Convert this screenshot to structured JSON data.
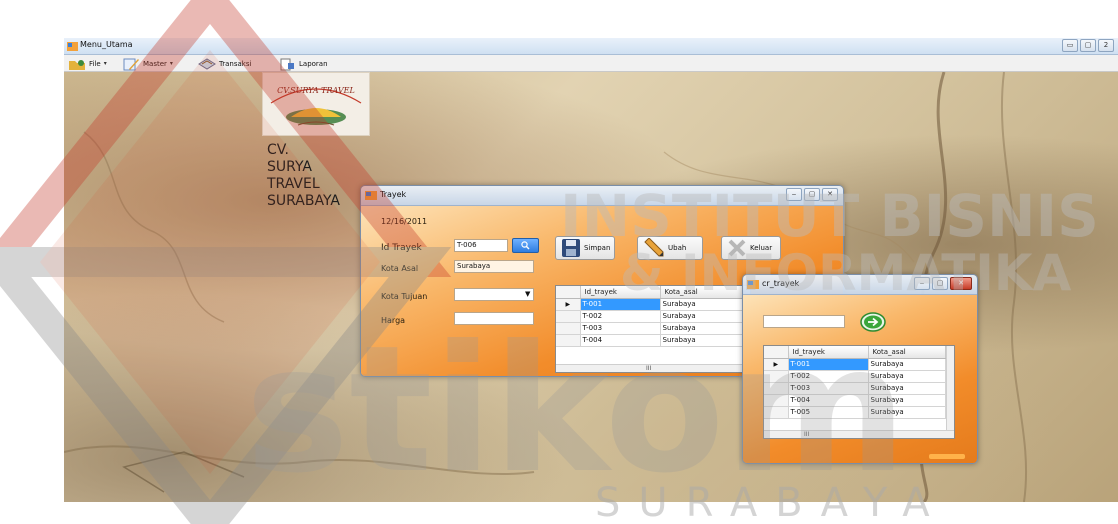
{
  "main_window": {
    "title": "Menu_Utama",
    "caption_buttons": [
      "▭",
      "▢",
      "2"
    ]
  },
  "menu": [
    {
      "label": "File",
      "icon": "folder-icon"
    },
    {
      "label": "Master",
      "icon": "notepad-icon"
    },
    {
      "label": "Transaksi",
      "icon": "book-icon"
    },
    {
      "label": "Laporan",
      "icon": "report-icon"
    }
  ],
  "logo": {
    "image_text": "CV.SURYA TRAVEL",
    "lines": [
      "CV.",
      "SURYA",
      "TRAVEL",
      "SURABAYA"
    ]
  },
  "trayek_dialog": {
    "title": "Trayek",
    "date": "12/16/2011",
    "id_label": "Id Trayek",
    "id_value": "T-006",
    "asal_label": "Kota Asal",
    "asal_value": "Surabaya",
    "tujuan_label": "Kota Tujuan",
    "tujuan_value": "",
    "harga_label": "Harga",
    "harga_value": "",
    "buttons": {
      "simpan": "Simpan",
      "ubah": "Ubah",
      "keluar": "Keluar"
    },
    "grid": {
      "columns": [
        "Id_trayek",
        "Kota_asal"
      ],
      "rows": [
        [
          "T-001",
          "Surabaya"
        ],
        [
          "T-002",
          "Surabaya"
        ],
        [
          "T-003",
          "Surabaya"
        ],
        [
          "T-004",
          "Surabaya"
        ]
      ],
      "scroll_text": "III"
    }
  },
  "cr_trayek_dialog": {
    "title": "cr_trayek",
    "search_value": "",
    "grid": {
      "columns": [
        "Id_trayek",
        "Kota_asal"
      ],
      "rows": [
        [
          "T-001",
          "Surabaya"
        ],
        [
          "T-002",
          "Surabaya"
        ],
        [
          "T-003",
          "Surabaya"
        ],
        [
          "T-004",
          "Surabaya"
        ],
        [
          "T-005",
          "Surabaya"
        ]
      ],
      "scroll_text": "III"
    }
  },
  "watermark": {
    "line1": "INSTITUT BISNIS",
    "line2": "& INFORMATIKA",
    "word": "stikom",
    "city": "SURABAYA"
  },
  "colors": {
    "dialog_orange": "#f28c2a",
    "selection": "#3399ff",
    "watermark_red": "#d44a2a"
  }
}
